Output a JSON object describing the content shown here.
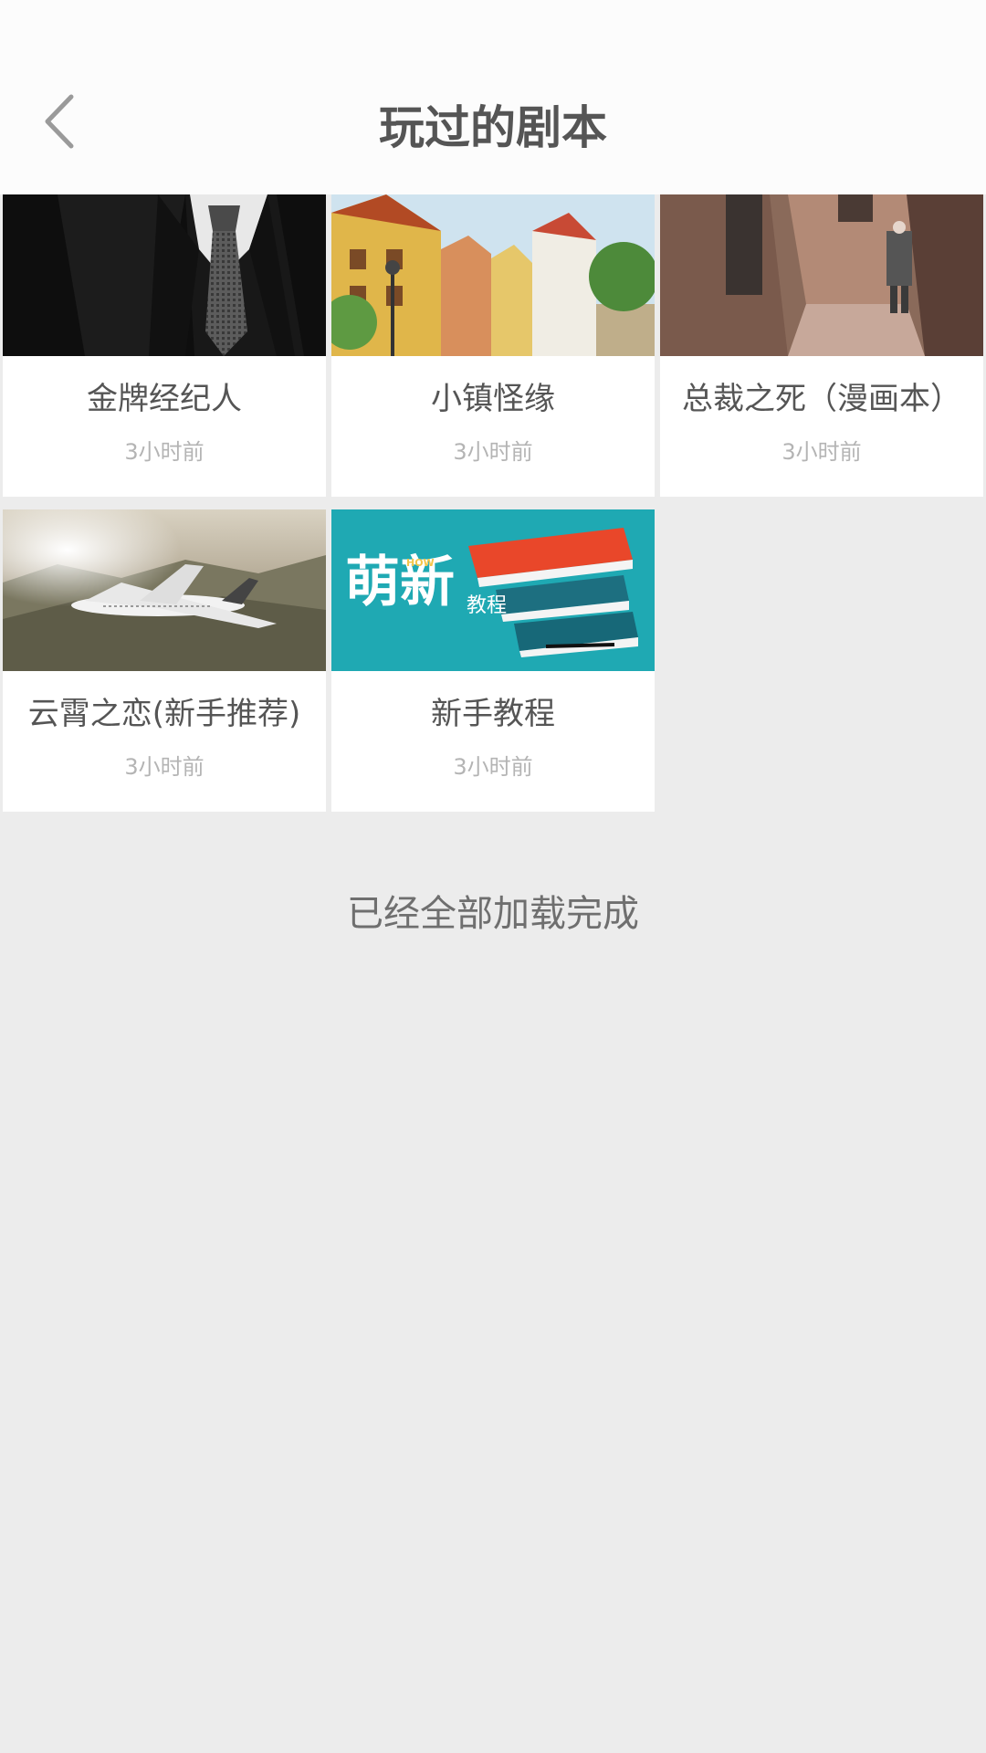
{
  "header": {
    "title": "玩过的剧本",
    "back_icon": "chevron-left-icon"
  },
  "scripts": [
    {
      "title": "金牌经纪人",
      "time": "3小时前",
      "thumb": "suit-and-tie"
    },
    {
      "title": "小镇怪缘",
      "time": "3小时前",
      "thumb": "painted-town-street"
    },
    {
      "title": "总裁之死（漫画本）",
      "time": "3小时前",
      "thumb": "old-man-in-alley"
    },
    {
      "title": "云霄之恋(新手推荐)",
      "time": "3小时前",
      "thumb": "airplane-over-mountains"
    },
    {
      "title": "新手教程",
      "time": "3小时前",
      "thumb": "newbie-tutorial-books",
      "thumb_text": {
        "big": "萌新",
        "small_tag": "HOW",
        "sub": "教程"
      }
    }
  ],
  "footer": {
    "message": "已经全部加载完成"
  },
  "colors": {
    "header_bg": "#fcfcfc",
    "page_bg": "#ececec",
    "title_text": "#555555",
    "time_text": "#b4b4b4",
    "tutorial_teal": "#1fa9b3"
  }
}
